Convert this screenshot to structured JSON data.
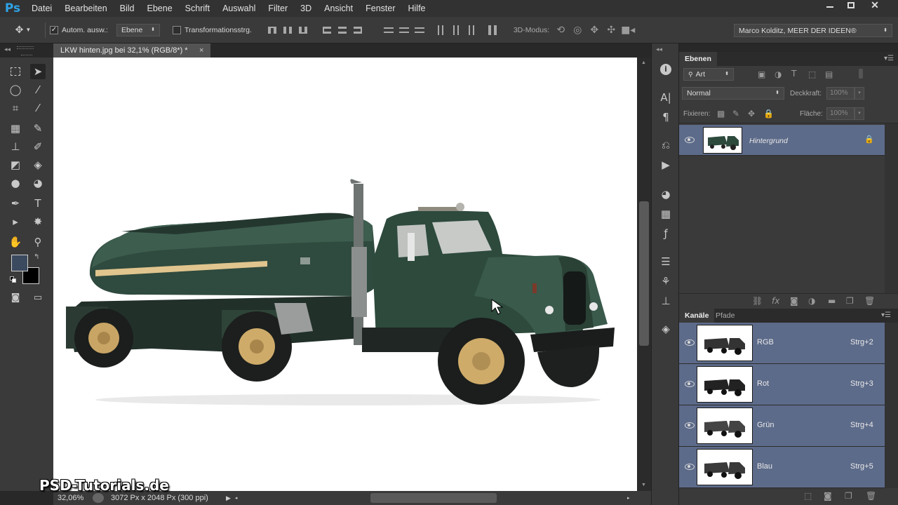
{
  "app": {
    "logo": "Ps"
  },
  "menu": [
    "Datei",
    "Bearbeiten",
    "Bild",
    "Ebene",
    "Schrift",
    "Auswahl",
    "Filter",
    "3D",
    "Ansicht",
    "Fenster",
    "Hilfe"
  ],
  "options": {
    "auto_select_label": "Autom. ausw.:",
    "auto_select_checked": true,
    "auto_select_value": "Ebene",
    "transform_label": "Transformationsstrg.",
    "transform_checked": false,
    "mode3d_label": "3D-Modus:",
    "workspace": "Marco Kolditz, MEER DER IDEEN®"
  },
  "document": {
    "tab_title": "LKW hinten.jpg bei 32,1% (RGB/8*) *",
    "close_glyph": "×"
  },
  "status": {
    "zoom": "32,06%",
    "doc_size": "3072 Px x 2048 Px (300 ppi)"
  },
  "layers_panel": {
    "tab": "Ebenen",
    "filter_kind": "Art",
    "blend_mode": "Normal",
    "opacity_label": "Deckkraft:",
    "opacity_value": "100%",
    "lock_label": "Fixieren:",
    "fill_label": "Fläche:",
    "fill_value": "100%",
    "layers": [
      {
        "name": "Hintergrund",
        "locked": true
      }
    ]
  },
  "channels_panel": {
    "tabs": [
      "Kanäle",
      "Pfade"
    ],
    "channels": [
      {
        "name": "RGB",
        "shortcut": "Strg+2"
      },
      {
        "name": "Rot",
        "shortcut": "Strg+3"
      },
      {
        "name": "Grün",
        "shortcut": "Strg+4"
      },
      {
        "name": "Blau",
        "shortcut": "Strg+5"
      }
    ]
  },
  "watermark": "PSD-Tutorials.de",
  "colors": {
    "accent": "#2fa3e6",
    "selection": "#5d6b8a",
    "truck_green": "#2d4a3d"
  }
}
